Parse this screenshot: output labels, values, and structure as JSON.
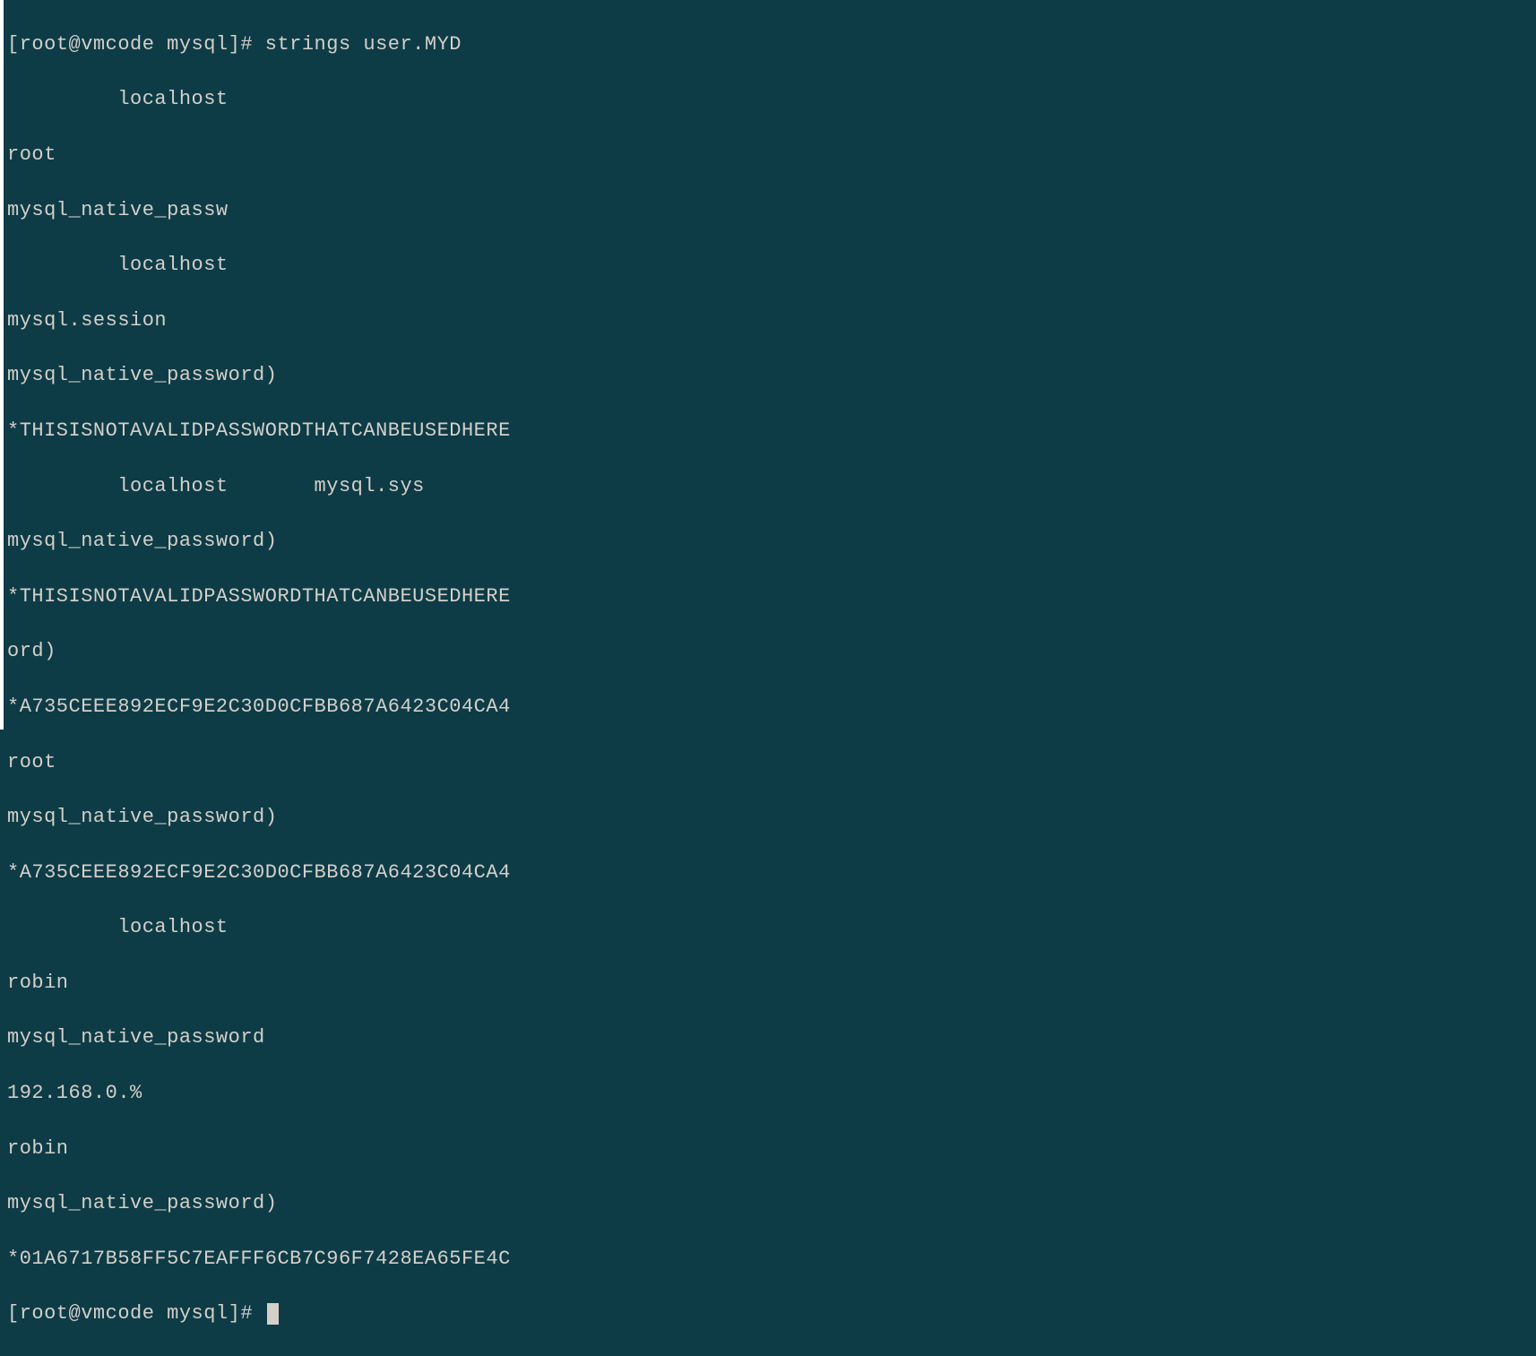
{
  "terminal": {
    "lines": [
      "[root@vmcode mysql]# strings user.MYD",
      "         localhost",
      "root",
      "mysql_native_passw",
      "         localhost",
      "mysql.session",
      "mysql_native_password)",
      "*THISISNOTAVALIDPASSWORDTHATCANBEUSEDHERE",
      "         localhost       mysql.sys",
      "mysql_native_password)",
      "*THISISNOTAVALIDPASSWORDTHATCANBEUSEDHERE",
      "ord)",
      "*A735CEEE892ECF9E2C30D0CFBB687A6423C04CA4",
      "root",
      "mysql_native_password)",
      "*A735CEEE892ECF9E2C30D0CFBB687A6423C04CA4",
      "         localhost",
      "robin",
      "mysql_native_password",
      "192.168.0.%",
      "robin",
      "mysql_native_password)",
      "*01A6717B58FF5C7EAFFF6CB7C96F7428EA65FE4C"
    ],
    "prompt": "[root@vmcode mysql]# "
  }
}
